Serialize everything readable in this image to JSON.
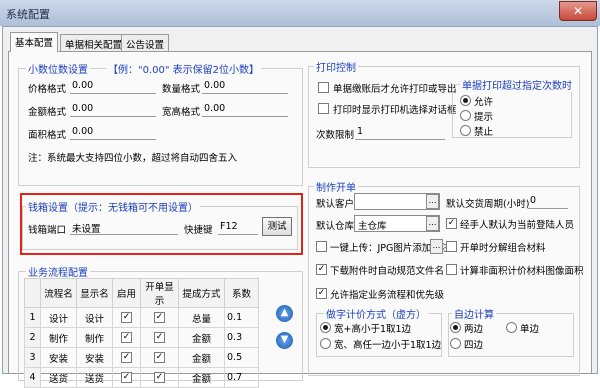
{
  "window": {
    "title": "系统配置",
    "close_glyph": "✕"
  },
  "tabs": [
    {
      "label": "基本配置",
      "active": true
    },
    {
      "label": "单据相关配置",
      "active": false
    },
    {
      "label": "公告设置",
      "active": false
    }
  ],
  "decimal": {
    "title": "小数位数设置",
    "hint": "【例：\"0.00\" 表示保留2位小数】",
    "price_label": "价格格式",
    "price_value": "0.00",
    "qty_label": "数量格式",
    "qty_value": "0.00",
    "amount_label": "金额格式",
    "amount_value": "0.00",
    "wh_label": "宽高格式",
    "wh_value": "0.00",
    "area_label": "面积格式",
    "area_value": "0.00",
    "note": "注：系统最大支持四位小数，超过将自动四舍五入"
  },
  "cashbox": {
    "title": "钱箱设置（提示：无钱箱可不用设置）",
    "port_label": "钱箱端口",
    "port_value": "未设置",
    "hotkey_label": "快捷键",
    "hotkey_value": "F12",
    "test_button": "测试"
  },
  "flow": {
    "title": "业务流程配置",
    "columns": [
      "流程名",
      "显示名",
      "启用",
      "开单显示",
      "提成方式",
      "系数"
    ],
    "rows": [
      {
        "num": "1",
        "name": "设计",
        "display": "设计",
        "enabled": true,
        "show": true,
        "method": "总量",
        "ratio": "0.1"
      },
      {
        "num": "2",
        "name": "制作",
        "display": "制作",
        "enabled": true,
        "show": true,
        "method": "金额",
        "ratio": "0.3"
      },
      {
        "num": "3",
        "name": "安装",
        "display": "安装",
        "enabled": true,
        "show": true,
        "method": "金额",
        "ratio": "0.5"
      },
      {
        "num": "4",
        "name": "送货",
        "display": "送货",
        "enabled": true,
        "show": true,
        "method": "金额",
        "ratio": "0.7"
      }
    ]
  },
  "print": {
    "title": "打印控制",
    "cb_audit_label": "单据缴账后才允许打印或导出",
    "cb_audit_checked": false,
    "cb_dialog_label": "打印时显示打印机选择对话框",
    "cb_dialog_checked": false,
    "count_label": "次数限制",
    "count_value": "1",
    "over_title": "单据打印超过指定次数时",
    "opt_allow": "允许",
    "opt_warn": "提示",
    "opt_forbid": "禁止",
    "selected": "允许"
  },
  "order": {
    "title": "制作开单",
    "customer_label": "默认客户",
    "customer_value": "",
    "cycle_label": "默认交货周期(小时)",
    "cycle_value": "0",
    "warehouse_label": "默认仓库",
    "warehouse_value": "主仓库",
    "cb_handler_label": "经手人默认为当前登陆人员",
    "cb_handler_checked": true,
    "cb_oneclick_label": "一键上传：JPG图片添加标注",
    "cb_oneclick_checked": false,
    "cb_combine_label": "开单时分解组合材料",
    "cb_combine_checked": false,
    "cb_filename_label": "下载附件时自动规范文件名",
    "cb_filename_checked": true,
    "cb_nonarea_label": "计算非面积计价材料图像面积",
    "cb_nonarea_checked": false,
    "cb_workflow_label": "允许指定业务流程和优先级",
    "cb_workflow_checked": true
  },
  "calc": {
    "title": "做字计价方式（虚方）",
    "opt_a": "宽+高小于1取1边",
    "opt_b": "宽、高任一边小于1取1边",
    "selected": "宽+高小于1取1边"
  },
  "side": {
    "title": "自边计算",
    "opt_two": "两边",
    "opt_single": "单边",
    "opt_four": "四边",
    "selected": "两边"
  },
  "colors": {
    "group_title": "#1b3fbf",
    "highlight": "#e2231a"
  }
}
